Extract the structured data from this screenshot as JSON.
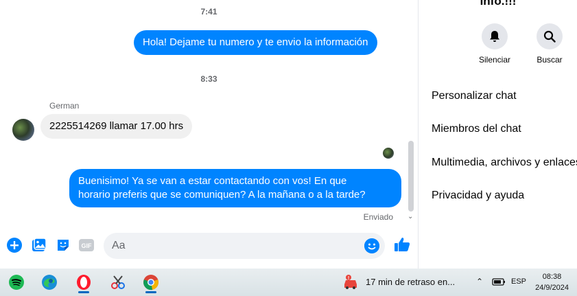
{
  "chat": {
    "timestamps": [
      "7:41",
      "8:33"
    ],
    "messages": {
      "out1": "Hola! Dejame tu numero y te envio la información",
      "in1": "2225514269 llamar 17.00 hrs",
      "out2_line1": "Buenisimo! Ya se van a estar contactando con vos! En que",
      "out2_line2": "horario preferis que se comuniquen? A la mañana o a la tarde?"
    },
    "sender_name": "German",
    "status": "Enviado"
  },
  "composer": {
    "placeholder": "Aa",
    "icons": [
      "plus-circle-icon",
      "image-icon",
      "sticker-icon",
      "gif-icon",
      "emoji-icon",
      "thumbs-up-icon"
    ],
    "gif_label": "GIF"
  },
  "info_panel": {
    "title": "Info.!!!",
    "actions": [
      {
        "label": "Silenciar",
        "icon": "bell-icon"
      },
      {
        "label": "Buscar",
        "icon": "search-icon"
      }
    ],
    "menu": [
      "Personalizar chat",
      "Miembros del chat",
      "Multimedia, archivos y enlaces",
      "Privacidad y ayuda"
    ]
  },
  "taskbar": {
    "apps": [
      "spotify-icon",
      "edge-icon",
      "opera-icon",
      "snipping-tool-icon",
      "chrome-icon"
    ],
    "traffic": "17 min de retraso en...",
    "language": "ESP",
    "time": "08:38",
    "date": "24/9/2024"
  },
  "colors": {
    "accent": "#0084ff",
    "bubble_in": "#f0f0f0",
    "text_secondary": "#65676b"
  }
}
